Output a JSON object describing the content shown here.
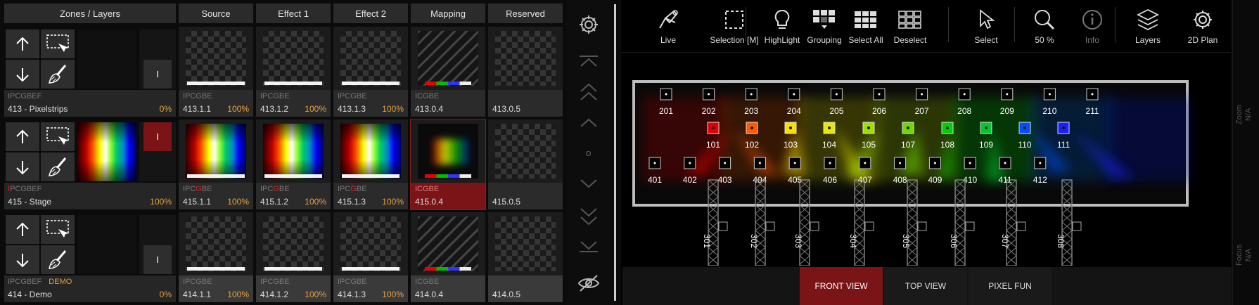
{
  "columns": [
    "Zones / Layers",
    "Source",
    "Effect 1",
    "Effect 2",
    "Mapping",
    "Reserved"
  ],
  "zones": [
    {
      "tags": "IPCGBEF",
      "tag_red": "",
      "tag_rest": "",
      "demo": "",
      "name": "413 - Pixelstrips",
      "percent": "0%",
      "lock_label": "I",
      "cells": [
        {
          "tags": "IPCGBE",
          "id": "413.1.1",
          "percent": "100%"
        },
        {
          "tags": "IPCGBE",
          "id": "413.1.2",
          "percent": "100%"
        },
        {
          "tags": "IPCGBE",
          "id": "413.1.3",
          "percent": "100%"
        },
        {
          "tags": "ICGBE",
          "id": "413.0.4",
          "percent": ""
        },
        {
          "tags": "",
          "id": "413.0.5",
          "percent": ""
        }
      ]
    },
    {
      "tags": "",
      "tag_red": "I",
      "tag_rest": "PCGBEF",
      "demo": "",
      "name": "415 - Stage",
      "percent": "100%",
      "lock_label": "I",
      "cells": [
        {
          "tags": "IPCGBE",
          "id": "415.1.1",
          "percent": "100%"
        },
        {
          "tags": "IPCGBE",
          "id": "415.1.2",
          "percent": "100%"
        },
        {
          "tags": "IPCGBE",
          "id": "415.1.3",
          "percent": "100%"
        },
        {
          "tags": "ICGBE",
          "id": "415.0.4",
          "percent": ""
        },
        {
          "tags": "",
          "id": "415.0.5",
          "percent": ""
        }
      ]
    },
    {
      "tags": "IPCGBEF",
      "tag_red": "",
      "tag_rest": "",
      "demo": "DEMO",
      "name": "414 - Demo",
      "percent": "0%",
      "lock_label": "I",
      "cells": [
        {
          "tags": "IPCGBE",
          "id": "414.1.1",
          "percent": "100%"
        },
        {
          "tags": "IPCGBE",
          "id": "414.1.2",
          "percent": "100%"
        },
        {
          "tags": "IPCGBE",
          "id": "414.1.3",
          "percent": "100%"
        },
        {
          "tags": "ICGBE",
          "id": "414.0.4",
          "percent": ""
        },
        {
          "tags": "",
          "id": "414.0.5",
          "percent": ""
        }
      ]
    }
  ],
  "toolbar": [
    {
      "label": "Live",
      "icon": "live-icon"
    },
    {
      "label": "Selection [M]",
      "icon": "selection-icon"
    },
    {
      "label": "HighLight",
      "icon": "bulb-icon"
    },
    {
      "label": "Grouping",
      "icon": "grouping-icon"
    },
    {
      "label": "Select All",
      "icon": "select-all-icon"
    },
    {
      "label": "Deselect",
      "icon": "deselect-icon"
    },
    {
      "label": "Select",
      "icon": "cursor-icon"
    },
    {
      "label": "50 %",
      "icon": "zoom-icon"
    },
    {
      "label": "Info",
      "icon": "info-icon"
    },
    {
      "label": "Layers",
      "icon": "layers-icon"
    },
    {
      "label": "2D Plan",
      "icon": "gear-icon"
    }
  ],
  "side": {
    "zoom_label": "Zoom",
    "zoom_value": "N/A",
    "focus_label": "Focus",
    "focus_value": "N/A"
  },
  "view_tabs": [
    "FRONT VIEW",
    "TOP VIEW",
    "PIXEL FUN"
  ],
  "fixtures": {
    "row200": [
      "201",
      "202",
      "203",
      "204",
      "205",
      "206",
      "207",
      "208",
      "209",
      "210",
      "211"
    ],
    "row100": [
      "101",
      "102",
      "103",
      "104",
      "105",
      "107",
      "108",
      "109",
      "110",
      "111"
    ],
    "row100_colors": [
      "#e00000",
      "#ff5a00",
      "#f5e000",
      "#e8e800",
      "#9be000",
      "#70d800",
      "#00d000",
      "#00c830",
      "#0050ff",
      "#1a20ff"
    ],
    "row400": [
      "401",
      "402",
      "403",
      "404",
      "405",
      "406",
      "407",
      "408",
      "409",
      "410",
      "411",
      "412"
    ],
    "truss": [
      "301",
      "302",
      "303",
      "304",
      "305",
      "306",
      "307",
      "308"
    ]
  },
  "colors": {
    "accent_red": "#7a1416",
    "percent": "#e8a33a",
    "tag_red": "#e02020"
  }
}
